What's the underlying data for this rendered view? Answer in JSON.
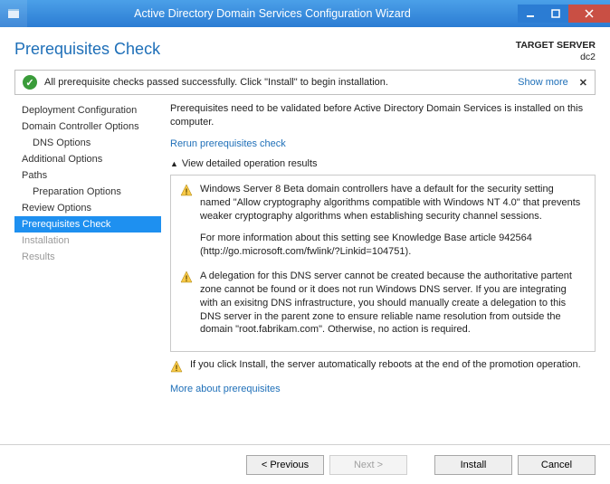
{
  "titlebar": {
    "title": "Active Directory Domain Services Configuration Wizard"
  },
  "header": {
    "pagetitle": "Prerequisites Check",
    "target_label": "TARGET SERVER",
    "target_server": "dc2"
  },
  "status": {
    "message": "All prerequisite checks passed successfully. Click \"Install\" to begin installation.",
    "showmore": "Show more"
  },
  "sidebar": {
    "items": [
      {
        "label": "Deployment Configuration",
        "indent": false,
        "selected": false,
        "disabled": false
      },
      {
        "label": "Domain Controller Options",
        "indent": false,
        "selected": false,
        "disabled": false
      },
      {
        "label": "DNS Options",
        "indent": true,
        "selected": false,
        "disabled": false
      },
      {
        "label": "Additional Options",
        "indent": false,
        "selected": false,
        "disabled": false
      },
      {
        "label": "Paths",
        "indent": false,
        "selected": false,
        "disabled": false
      },
      {
        "label": "Preparation Options",
        "indent": true,
        "selected": false,
        "disabled": false
      },
      {
        "label": "Review Options",
        "indent": false,
        "selected": false,
        "disabled": false
      },
      {
        "label": "Prerequisites Check",
        "indent": false,
        "selected": true,
        "disabled": false
      },
      {
        "label": "Installation",
        "indent": false,
        "selected": false,
        "disabled": true
      },
      {
        "label": "Results",
        "indent": false,
        "selected": false,
        "disabled": true
      }
    ]
  },
  "main": {
    "intro": "Prerequisites need to be validated before Active Directory Domain Services is installed on this computer.",
    "rerun_link": "Rerun prerequisites check",
    "section_head": "View detailed operation results",
    "results": [
      {
        "p1": "Windows Server 8 Beta domain controllers have a default for the security setting named \"Allow cryptography algorithms compatible with Windows NT 4.0\" that prevents weaker cryptography algorithms when establishing security channel sessions.",
        "p2": "For more information about this setting see Knowledge Base article 942564 (http://go.microsoft.com/fwlink/?Linkid=104751)."
      },
      {
        "p1": "A delegation for this DNS server cannot be created because the authoritative partent zone cannot be found or it does not run Windows DNS server. If you are integrating with an exisitng DNS infrastructure, you should manually create a delegation to this DNS server in the parent zone to ensure reliable name resolution from outside the domain \"root.fabrikam.com\". Otherwise, no action is required."
      }
    ],
    "footnote": "If you click Install, the server automatically reboots at the end of the promotion operation.",
    "more_link": "More about prerequisites"
  },
  "footer": {
    "previous": "< Previous",
    "next": "Next >",
    "install": "Install",
    "cancel": "Cancel"
  }
}
